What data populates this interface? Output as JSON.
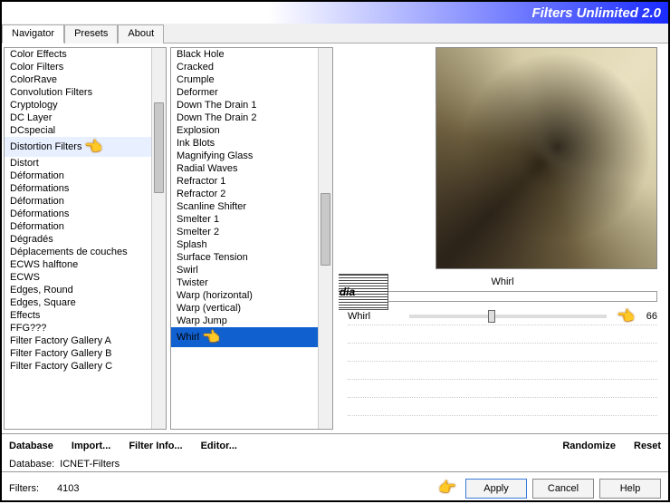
{
  "header": {
    "title": "Filters Unlimited 2.0"
  },
  "tabs": [
    {
      "label": "Navigator",
      "active": true
    },
    {
      "label": "Presets",
      "active": false
    },
    {
      "label": "About",
      "active": false
    }
  ],
  "categories": [
    "Color Effects",
    "Color Filters",
    "ColorRave",
    "Convolution Filters",
    "Cryptology",
    "DC Layer",
    "DCspecial",
    "Distortion Filters",
    "Distort",
    "Déformation",
    "Déformations",
    "Déformation",
    "Déformations",
    "Déformation",
    "Dégradés",
    "Déplacements de couches",
    "ECWS halftone",
    "ECWS",
    "Edges, Round",
    "Edges, Square",
    "Effects",
    "FFG???",
    "Filter Factory Gallery A",
    "Filter Factory Gallery B",
    "Filter Factory Gallery C"
  ],
  "categories_selected_index": 7,
  "filters": [
    "Black Hole",
    "Cracked",
    "Crumple",
    "Deformer",
    "Down The Drain 1",
    "Down The Drain 2",
    "Explosion",
    "Ink Blots",
    "Magnifying Glass",
    "Radial Waves",
    "Refractor 1",
    "Refractor 2",
    "Scanline Shifter",
    "Smelter 1",
    "Smelter 2",
    "Splash",
    "Surface Tension",
    "Swirl",
    "Twister",
    "Warp (horizontal)",
    "Warp (vertical)",
    "Warp Jump",
    "Whirl"
  ],
  "filters_selected_index": 22,
  "current_filter": "Whirl",
  "params": [
    {
      "label": "Whirl",
      "value": 66,
      "pos": 40
    }
  ],
  "toolbar": {
    "database": "Database",
    "import": "Import...",
    "filter_info": "Filter Info...",
    "editor": "Editor...",
    "randomize": "Randomize",
    "reset": "Reset"
  },
  "status": {
    "db_label": "Database:",
    "db_value": "ICNET-Filters",
    "filters_label": "Filters:",
    "filters_value": "4103"
  },
  "footer": {
    "apply": "Apply",
    "cancel": "Cancel",
    "help": "Help"
  },
  "watermark": "claudia"
}
